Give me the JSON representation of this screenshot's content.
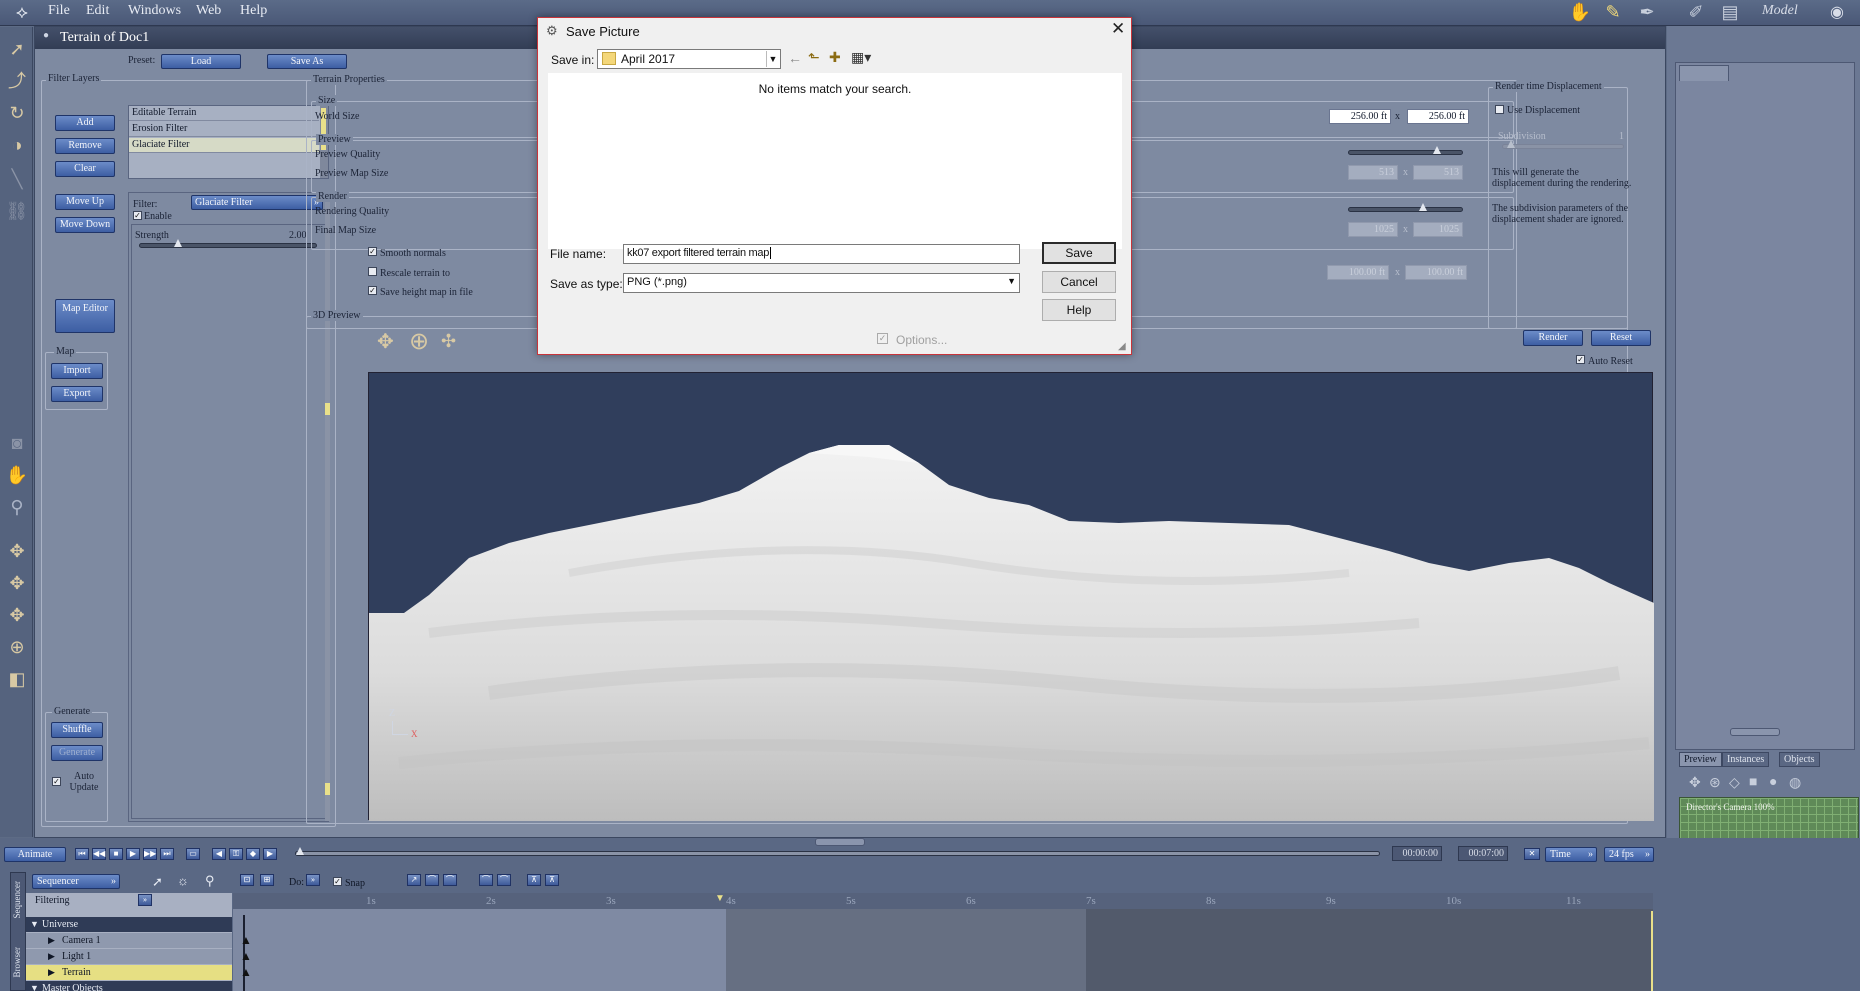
{
  "menubar": {
    "items": [
      "File",
      "Edit",
      "Windows",
      "Web",
      "Help"
    ],
    "mode_label": "Model"
  },
  "terrain_window": {
    "title": "Terrain of Doc1",
    "preset_label": "Preset:",
    "load_label": "Load",
    "save_as_label": "Save As"
  },
  "filter_layers": {
    "title": "Filter Layers",
    "buttons": {
      "add": "Add",
      "remove": "Remove",
      "clear": "Clear",
      "move_up": "Move Up",
      "move_down": "Move Down",
      "map_editor": "Map Editor"
    },
    "layers": [
      "Editable Terrain",
      "Erosion Filter",
      "Glaciate Filter"
    ],
    "selected_index": 2,
    "filter_label": "Filter:",
    "filter_value": "Glaciate Filter",
    "enable_label": "Enable",
    "strength_label": "Strength",
    "strength_value": "2.00",
    "strength_fraction": 0.2,
    "map_group": "Map",
    "import_label": "Import",
    "export_label": "Export",
    "generate_group": "Generate",
    "shuffle_label": "Shuffle",
    "generate_label": "Generate",
    "auto_update_label": "Auto Update"
  },
  "terrain_props": {
    "title": "Terrain Properties",
    "size_group": "Size",
    "world_size_label": "World Size",
    "world_x": "256.00 ft",
    "world_y": "256.00 ft",
    "x_sep": "x",
    "preview_group": "Preview",
    "preview_quality_label": "Preview Quality",
    "preview_map_size_label": "Preview Map Size",
    "preview_map_x": "513",
    "preview_map_y": "513",
    "render_group": "Render",
    "rendering_quality_label": "Rendering Quality",
    "final_map_size_label": "Final Map Size",
    "final_map_x": "1025",
    "final_map_y": "1025",
    "smooth_normals_label": "Smooth normals",
    "rescale_label": "Rescale terrain to",
    "rescale_x": "100.00 ft",
    "rescale_y": "100.00 ft",
    "save_height_label": "Save height map in file"
  },
  "render_disp": {
    "title": "Render time Displacement",
    "use_disp_label": "Use Displacement",
    "subdivision_label": "Subdivision",
    "subdivision_value": "1",
    "desc1": "This will generate the displacement during the rendering.",
    "desc2": "The subdivision parameters of the displacement shader are ignored."
  },
  "preview3d": {
    "title": "3D Preview",
    "render_label": "Render",
    "reset_label": "Reset",
    "auto_reset_label": "Auto Reset",
    "axis_z": "Z",
    "axis_x": "X"
  },
  "timeline": {
    "animate_label": "Animate",
    "time_start": "00:00:00",
    "time_end": "00:07:00",
    "time_mode": "Time",
    "fps": "24 fps",
    "sequencer_label": "Sequencer",
    "do_label": "Do:",
    "snap_label": "Snap",
    "filtering_label": "Filtering",
    "side_tab1": "Sequencer",
    "side_tab2": "Browser",
    "ticks": [
      "1s",
      "2s",
      "3s",
      "4s",
      "5s",
      "6s",
      "7s",
      "8s",
      "9s",
      "10s",
      "11s"
    ],
    "rows": [
      {
        "label": "Universe",
        "indent": 0,
        "expanded": true
      },
      {
        "label": "Camera 1",
        "indent": 1,
        "expanded": false
      },
      {
        "label": "Light 1",
        "indent": 1,
        "expanded": false
      },
      {
        "label": "Terrain",
        "indent": 1,
        "expanded": false
      },
      {
        "label": "Master Objects",
        "indent": 0,
        "expanded": true
      }
    ]
  },
  "right_panel": {
    "tabs": [
      "Preview",
      "Instances",
      "Objects"
    ],
    "camera_label": "Director's Camera 100%"
  },
  "dialog": {
    "title": "Save Picture",
    "save_in_label": "Save in:",
    "save_in_value": "April 2017",
    "empty_message": "No items match your search.",
    "file_name_label": "File name:",
    "file_name_value": "kk07 export filtered terrain map",
    "save_as_type_label": "Save as type:",
    "save_as_type_value": "PNG (*.png)",
    "save_label": "Save",
    "cancel_label": "Cancel",
    "help_label": "Help",
    "options_label": "Options..."
  }
}
